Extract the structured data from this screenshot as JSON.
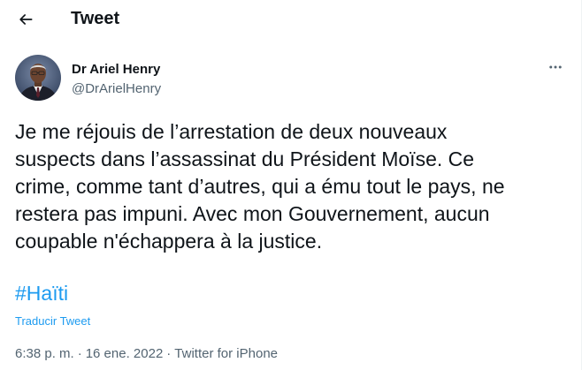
{
  "header": {
    "back_icon": "arrow-left-icon",
    "title": "Tweet"
  },
  "author": {
    "avatar_icon": "avatar",
    "name": "Dr Ariel Henry",
    "handle": "@DrArielHenry"
  },
  "more_icon": "more-horizontal-icon",
  "tweet": {
    "text": "Je me réjouis de l’arrestation de deux nouveaux\nsuspects dans l’assassinat du Président Moïse. Ce\ncrime, comme tant d’autres, qui a ému tout le pays, ne\nrestera pas impuni. Avec mon Gouvernement, aucun\ncoupable n'échappera à la justice.",
    "hashtag": "#Haïti",
    "translate_label": "Traducir Tweet"
  },
  "meta": {
    "time": "6:38 p. m.",
    "separator": "·",
    "date": "16 ene. 2022",
    "source": "Twitter for iPhone"
  },
  "colors": {
    "accent": "#1d9bf0",
    "text_primary": "#0f1419",
    "text_secondary": "#536471"
  }
}
